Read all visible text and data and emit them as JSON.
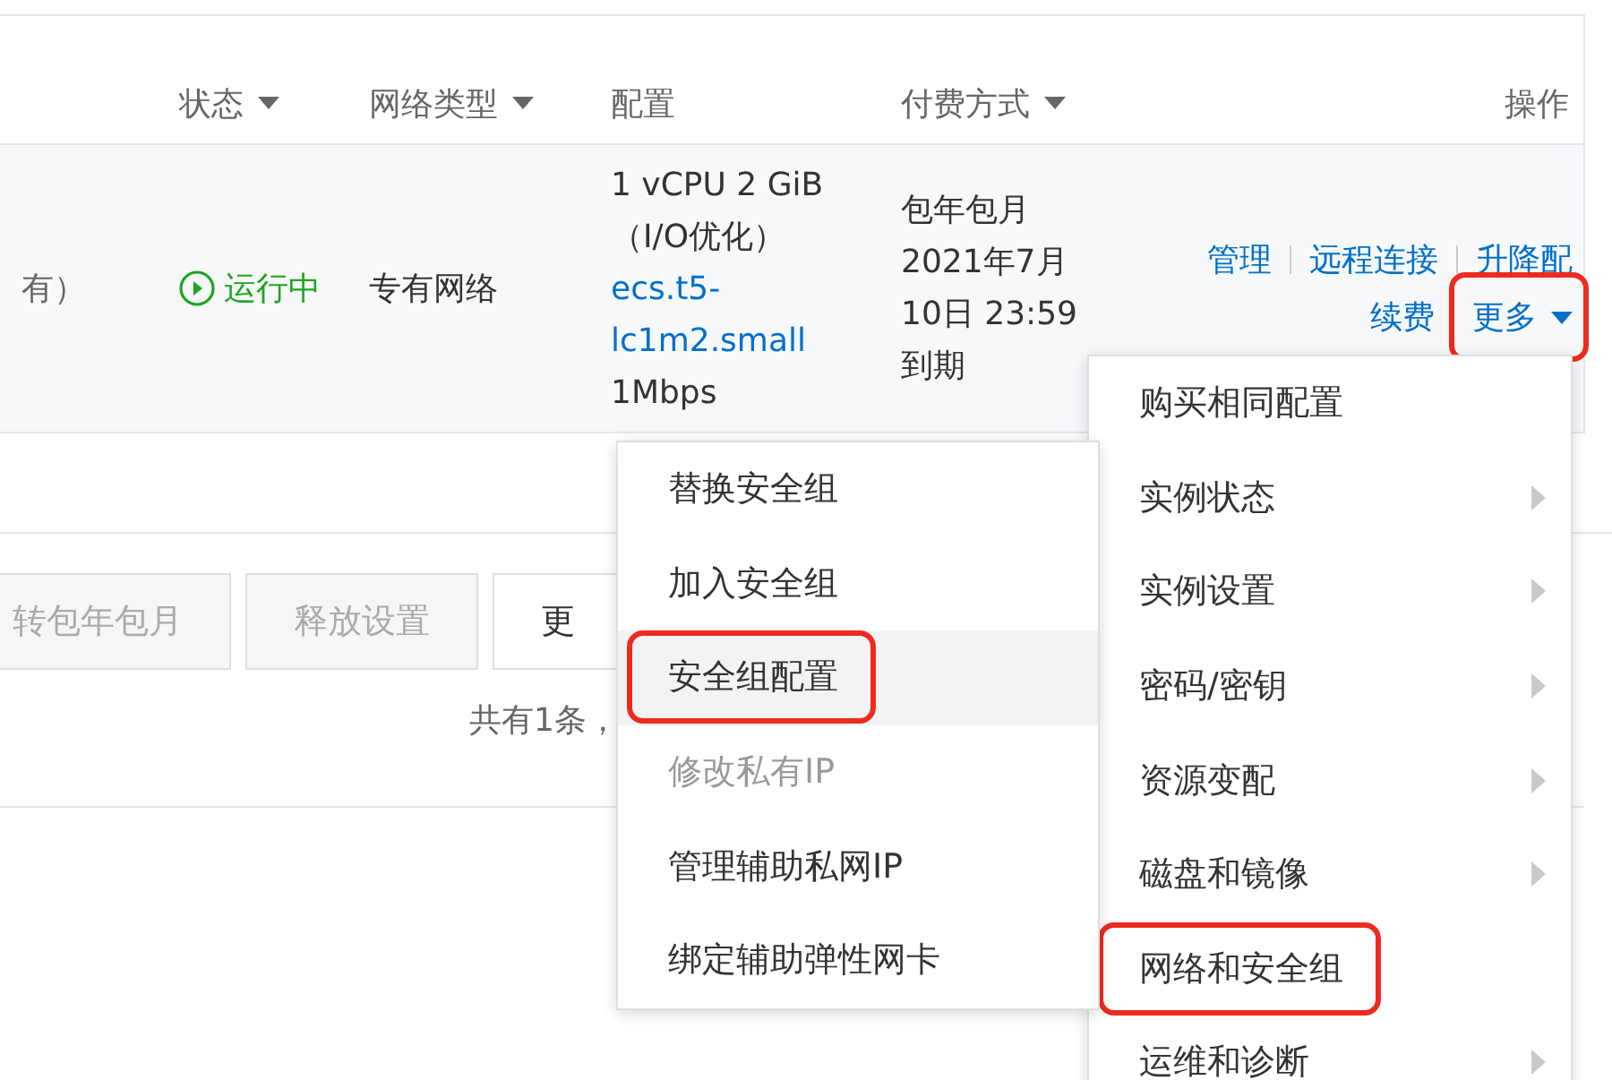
{
  "table": {
    "columns": [
      {
        "label": "状态",
        "filter": true
      },
      {
        "label": "网络类型",
        "filter": true
      },
      {
        "label": "配置",
        "filter": false
      },
      {
        "label": "付费方式",
        "filter": true
      },
      {
        "label": "操作",
        "filter": false
      }
    ],
    "rows": [
      {
        "column_1": "有）",
        "status": {
          "text": "运行中",
          "kind": "running"
        },
        "network": "专有网络",
        "config": {
          "lines": [
            "1 vCPU 2 GiB",
            "（I/O优化）"
          ],
          "link": "ecs.t5-lc1m2.small",
          "bandwidth": "1Mbps"
        },
        "payment": [
          "包年包月",
          "2021年7月",
          "10日 23:59",
          "到期"
        ],
        "action_lines": [
          [
            {
              "label": "管理",
              "dropdown": false,
              "highlighted": false
            },
            {
              "label": "远程连接",
              "dropdown": false,
              "highlighted": false
            },
            {
              "label": "升降配",
              "dropdown": false,
              "highlighted": false
            }
          ],
          [
            {
              "label": "续费",
              "dropdown": false,
              "highlighted": false
            },
            {
              "label": "更多",
              "dropdown": true,
              "highlighted": true
            }
          ]
        ]
      }
    ]
  },
  "batch_buttons": [
    {
      "label": "转包年包月",
      "disabled": true
    },
    {
      "label": "释放设置",
      "disabled": true
    },
    {
      "label": "更",
      "disabled": false
    }
  ],
  "footer": "共有1条，",
  "more_menu": {
    "items": [
      {
        "label": "购买相同配置",
        "submenu": false,
        "highlighted": false
      },
      {
        "label": "实例状态",
        "submenu": true,
        "highlighted": false
      },
      {
        "label": "实例设置",
        "submenu": true,
        "highlighted": false
      },
      {
        "label": "密码/密钥",
        "submenu": true,
        "highlighted": false
      },
      {
        "label": "资源变配",
        "submenu": true,
        "highlighted": false
      },
      {
        "label": "磁盘和镜像",
        "submenu": true,
        "highlighted": false
      },
      {
        "label": "网络和安全组",
        "submenu": false,
        "highlighted": true
      },
      {
        "label": "运维和诊断",
        "submenu": true,
        "highlighted": false
      }
    ]
  },
  "submenu": {
    "items": [
      {
        "label": "替换安全组",
        "disabled": false,
        "selected": false,
        "highlighted": false
      },
      {
        "label": "加入安全组",
        "disabled": false,
        "selected": false,
        "highlighted": false
      },
      {
        "label": "安全组配置",
        "disabled": false,
        "selected": true,
        "highlighted": true
      },
      {
        "label": "修改私有IP",
        "disabled": true,
        "selected": false,
        "highlighted": false
      },
      {
        "label": "管理辅助私网IP",
        "disabled": false,
        "selected": false,
        "highlighted": false
      },
      {
        "label": "绑定辅助弹性网卡",
        "disabled": false,
        "selected": false,
        "highlighted": false
      }
    ]
  }
}
